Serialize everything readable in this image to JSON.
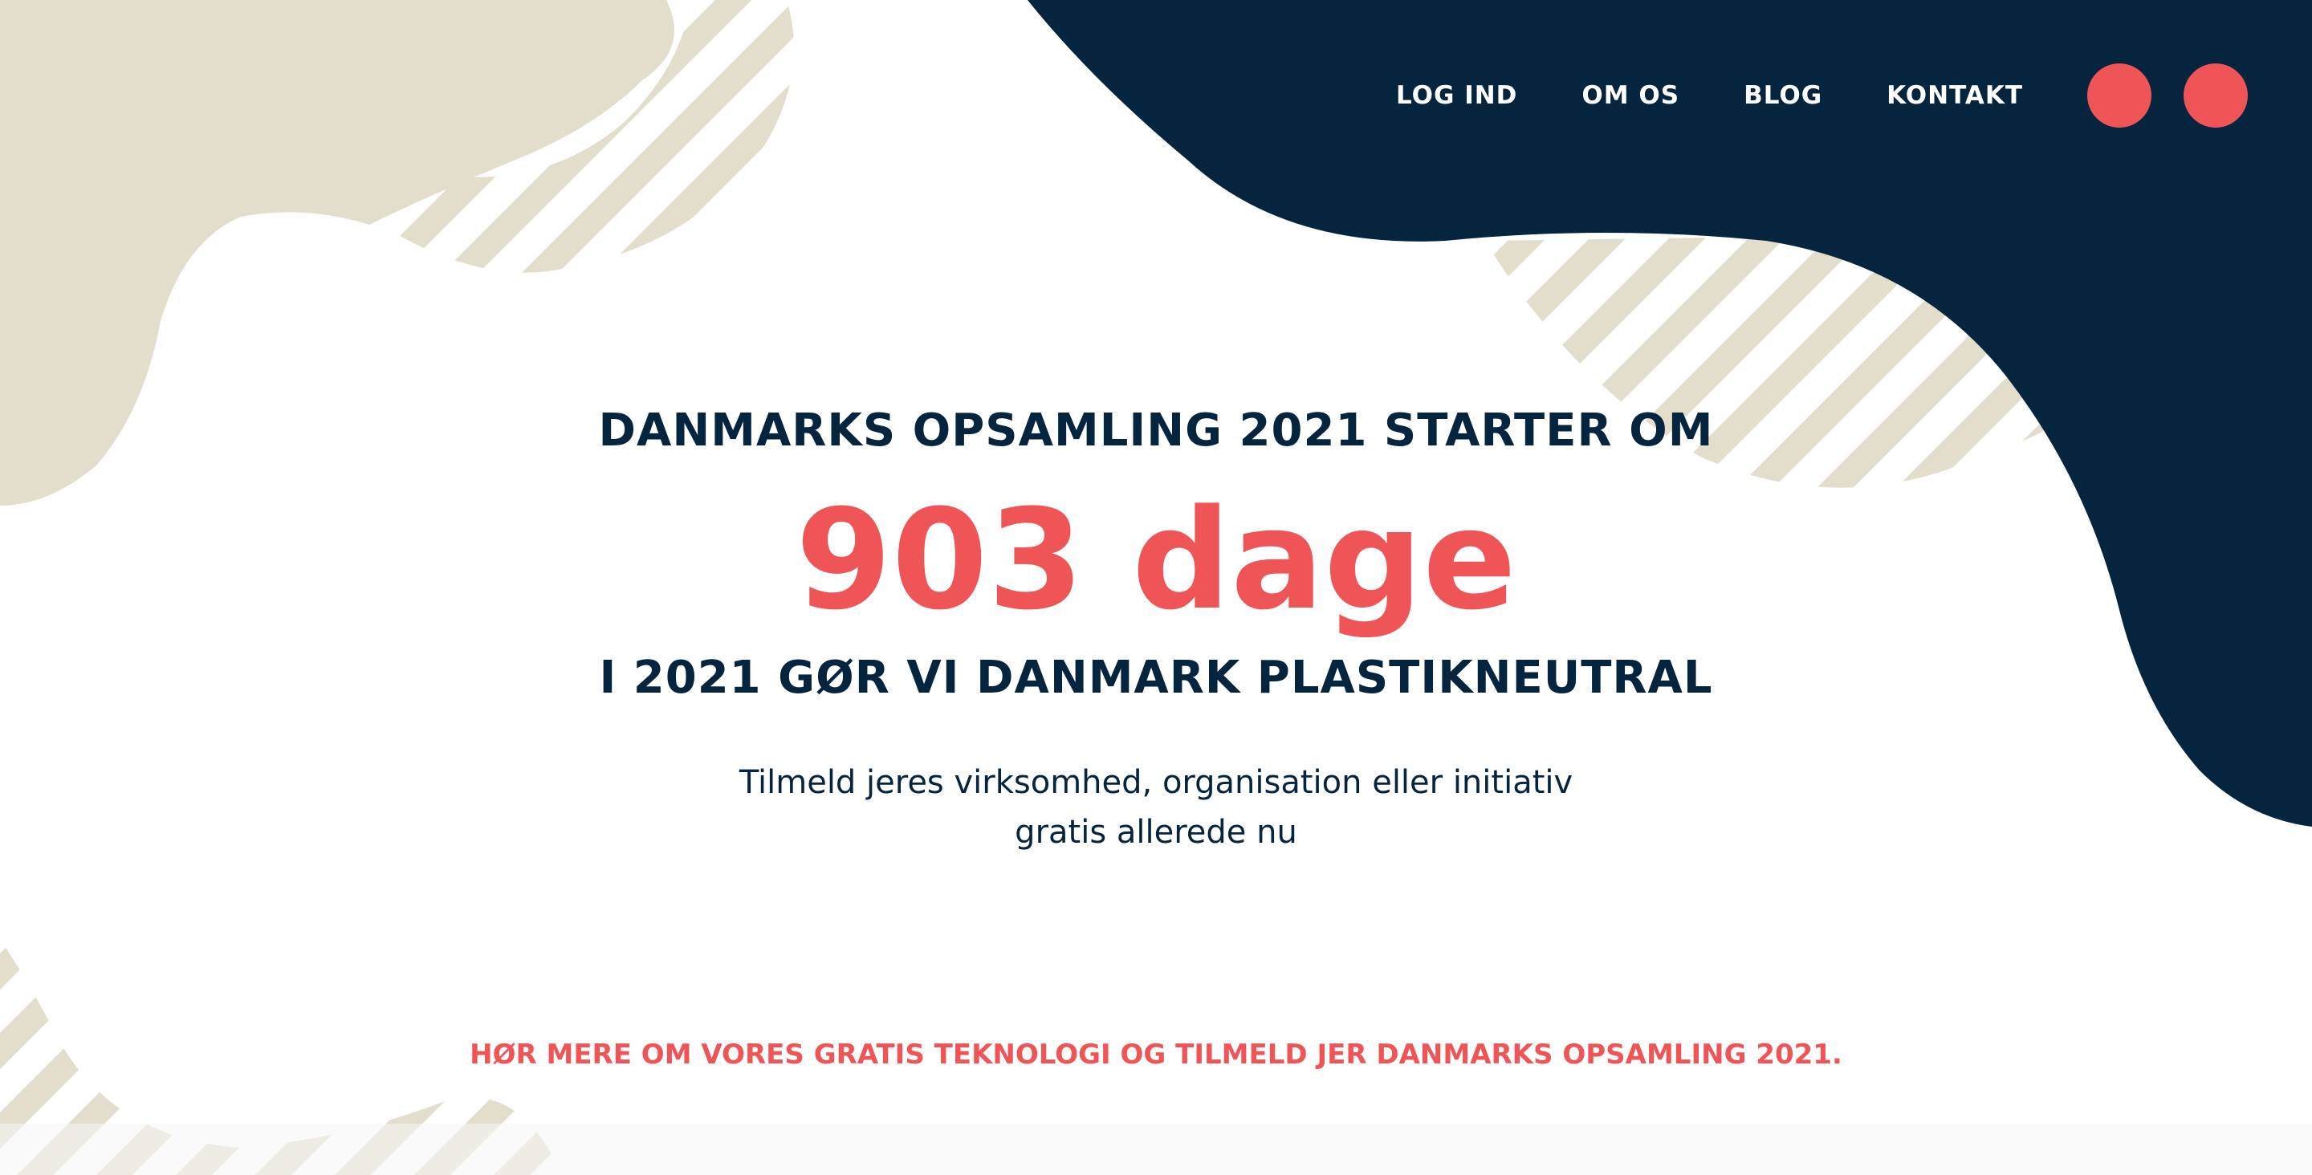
{
  "nav": {
    "items": [
      {
        "label": "LOG IND"
      },
      {
        "label": "OM OS"
      },
      {
        "label": "BLOG"
      },
      {
        "label": "KONTAKT"
      }
    ]
  },
  "hero": {
    "eyebrow": "DANMARKS OPSAMLING 2021 STARTER OM",
    "countdown": "903 dage",
    "subheadline": "I 2021 GØR VI DANMARK PLASTIKNEUTRAL",
    "lead": "Tilmeld jeres virksomhed, organisation eller initiativ gratis allerede nu",
    "cta": "HØR MERE OM VORES GRATIS TEKNOLOGI OG TILMELD JER DANMARKS OPSAMLING 2021."
  },
  "colors": {
    "navy": "#05253f",
    "coral": "#ef5456",
    "beige": "#e3ddcb",
    "white": "#ffffff"
  }
}
